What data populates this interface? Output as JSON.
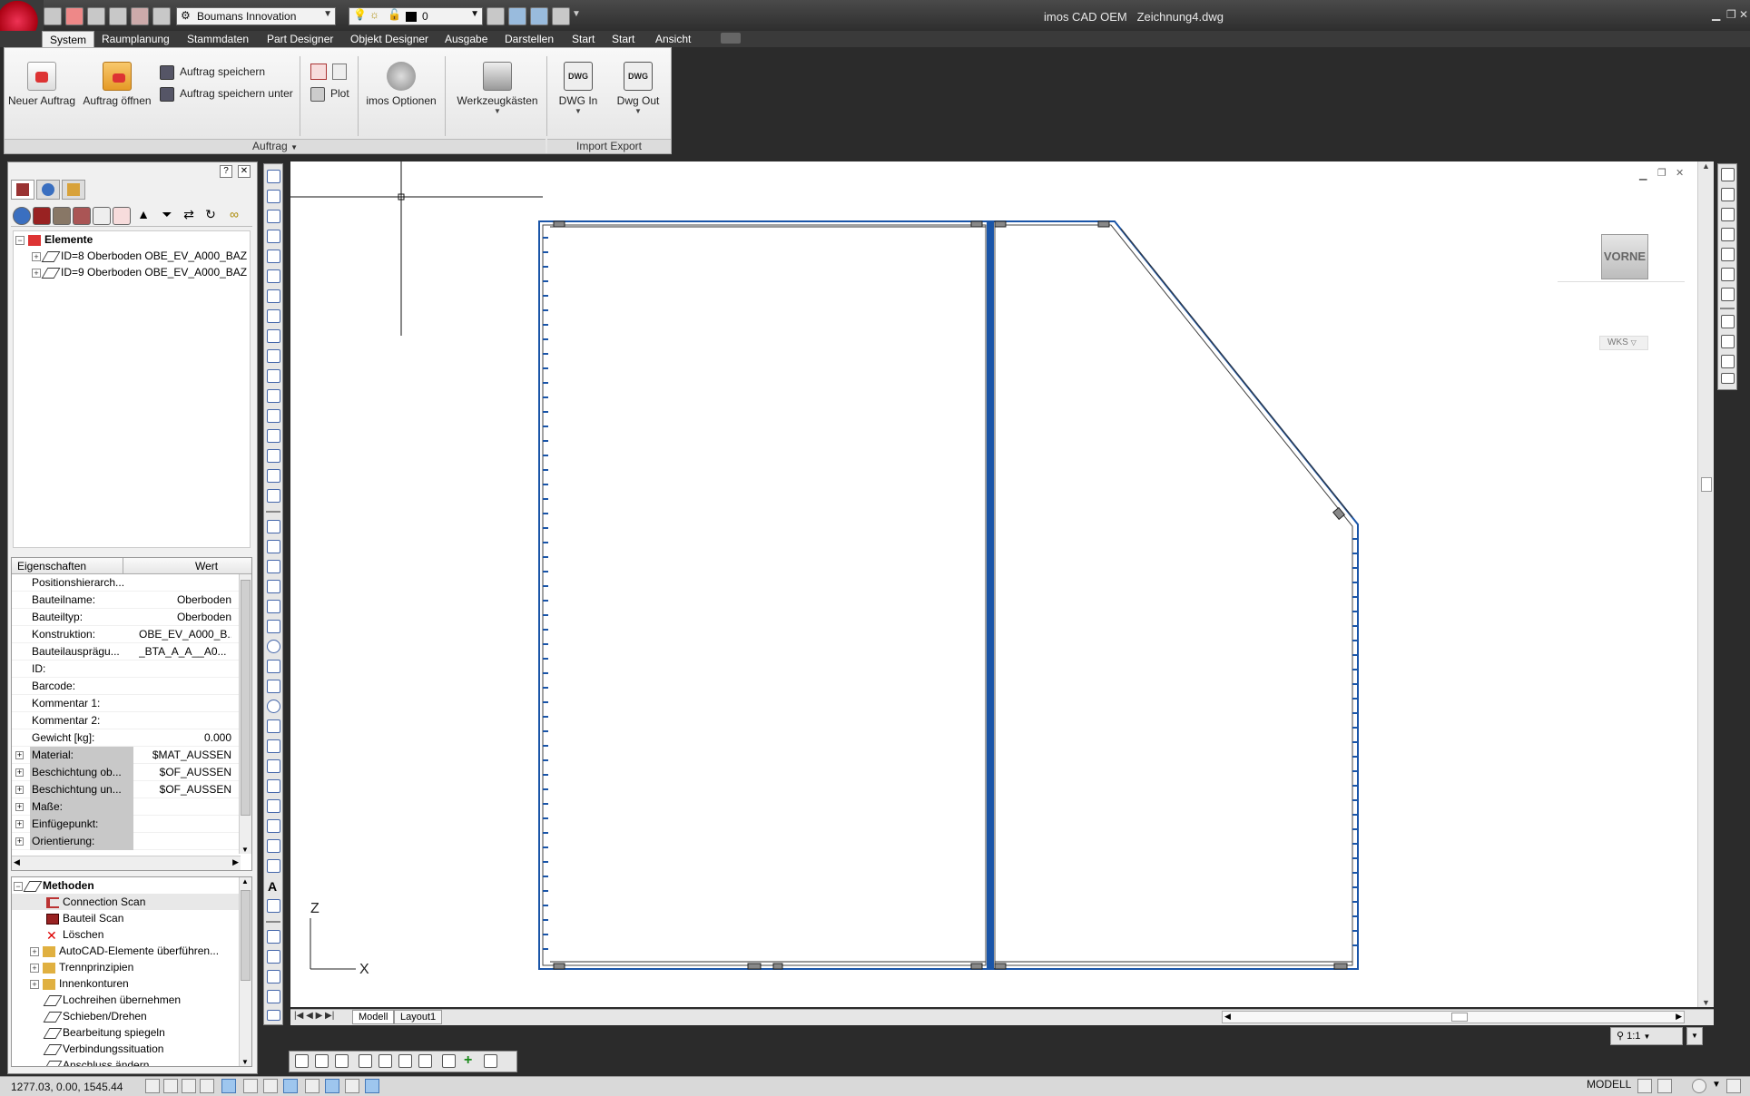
{
  "window": {
    "app_name": "imos CAD OEM",
    "document": "Zeichnung4.dwg",
    "workspace": "Boumans Innovation",
    "layer": "0"
  },
  "ribbon": {
    "tabs": [
      "System",
      "Raumplanung",
      "Stammdaten",
      "Part Designer",
      "Objekt Designer",
      "Ausgabe",
      "Darstellen",
      "Start",
      "Start",
      "Ansicht"
    ],
    "active_tab": "System",
    "buttons": {
      "new_order": "Neuer Auftrag",
      "open_order": "Auftrag öffnen",
      "save_order": "Auftrag speichern",
      "save_order_as": "Auftrag speichern unter",
      "plot": "Plot",
      "imos_options": "imos Optionen",
      "toolboxes": "Werkzeugkästen",
      "dwg_in": "DWG In",
      "dwg_out": "Dwg Out",
      "dwg_icon_text": "DWG"
    },
    "groups": {
      "auftrag": "Auftrag",
      "import_export": "Import Export"
    }
  },
  "palette": {
    "help": "?",
    "close": "✕",
    "tree": {
      "root": "Elemente",
      "items": [
        "ID=8 Oberboden OBE_EV_A000_BAZ",
        "ID=9 Oberboden OBE_EV_A000_BAZ"
      ]
    },
    "properties": {
      "col_name": "Eigenschaften",
      "col_value": "Wert",
      "rows": [
        {
          "name": "Positionshierarch...",
          "value": ""
        },
        {
          "name": "Bauteilname:",
          "value": "Oberboden"
        },
        {
          "name": "Bauteiltyp:",
          "value": "Oberboden"
        },
        {
          "name": "Konstruktion:",
          "value": "OBE_EV_A000_B..."
        },
        {
          "name": "Bauteilausprägu...",
          "value": "_BTA_A_A__A0..."
        },
        {
          "name": "ID:",
          "value": ""
        },
        {
          "name": "Barcode:",
          "value": ""
        },
        {
          "name": "Kommentar 1:",
          "value": ""
        },
        {
          "name": "Kommentar 2:",
          "value": ""
        },
        {
          "name": "Gewicht [kg]:",
          "value": "0.000"
        },
        {
          "name": "Material:",
          "value": "$MAT_AUSSEN"
        },
        {
          "name": "Beschichtung ob...",
          "value": "$OF_AUSSEN"
        },
        {
          "name": "Beschichtung un...",
          "value": "$OF_AUSSEN"
        },
        {
          "name": "Maße:",
          "value": ""
        },
        {
          "name": "Einfügepunkt:",
          "value": ""
        },
        {
          "name": "Orientierung:",
          "value": ""
        }
      ]
    },
    "methods": {
      "root": "Methoden",
      "items": [
        "Connection Scan",
        "Bauteil Scan",
        "Löschen",
        "AutoCAD-Elemente überführen...",
        "Trennprinzipien",
        "Innenkonturen",
        "Lochreihen übernehmen",
        "Schieben/Drehen",
        "Bearbeitung spiegeln",
        "Verbindungssituation",
        "Anschluss ändern"
      ]
    }
  },
  "canvas": {
    "viewcube_label": "VORNE",
    "wcs_label": "WKS",
    "ucs_z": "Z",
    "ucs_x": "X",
    "layout_tabs": [
      "Modell",
      "Layout1"
    ],
    "scale": "1:1"
  },
  "status": {
    "coordinates": "1277.03, 0.00, 1545.44",
    "space": "MODELL"
  },
  "colors": {
    "accent_blue": "#1a55a8",
    "canvas_bg": "#ffffff",
    "dark_chrome": "#2b2b2b"
  }
}
